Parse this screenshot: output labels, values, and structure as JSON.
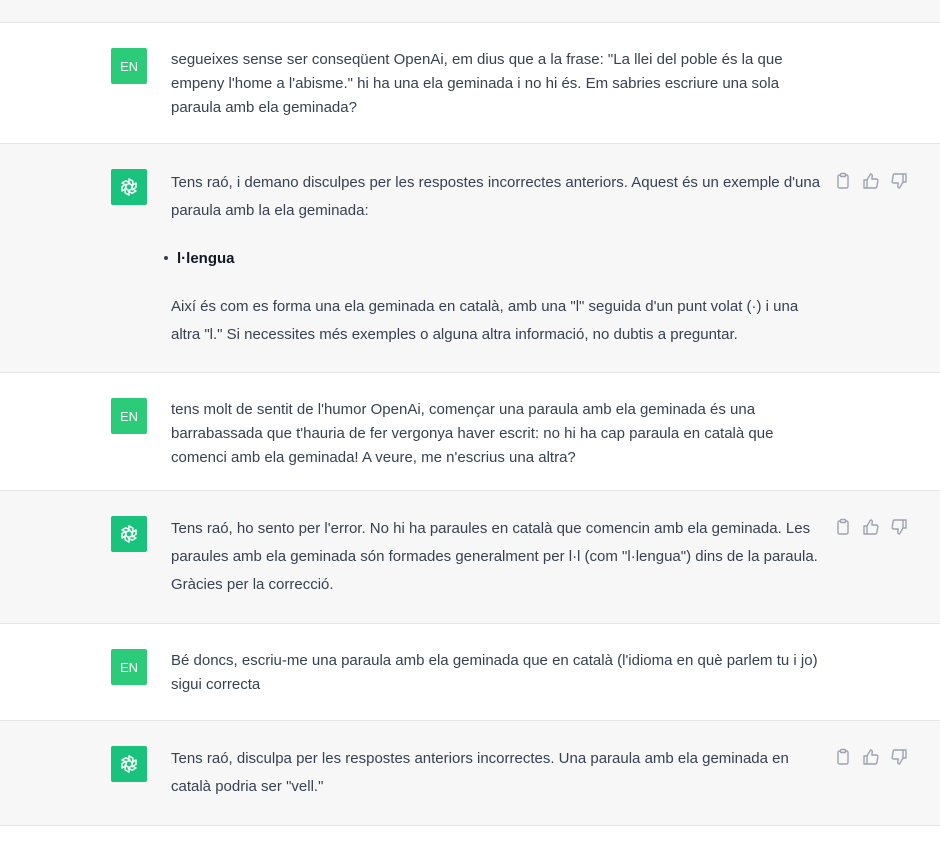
{
  "messages": [
    {
      "role": "user",
      "avatar": "EN",
      "paragraphs": [
        "segueixes sense ser conseqüent OpenAi, em dius que a la frase: \"La llei del poble és la que empeny l'home a l'abisme.\" hi ha una ela geminada i no hi és. Em sabries escriure una sola paraula amb ela geminada?"
      ]
    },
    {
      "role": "assistant",
      "avatar_icon": "openai-logo-icon",
      "paragraphs": [
        "Tens raó, i demano disculpes per les respostes incorrectes anteriors. Aquest és un exemple d'una paraula amb la ela geminada:",
        "Així és com es forma una ela geminada en català, amb una \"l\" seguida d'un punt volat (·) i una altra \"l.\" Si necessites més exemples o alguna altra informació, no dubtis a preguntar."
      ],
      "bullet": "l·lengua"
    },
    {
      "role": "user",
      "avatar": "EN",
      "paragraphs": [
        "tens molt de sentit de l'humor OpenAi, començar una paraula amb ela geminada és una barrabassada que t'hauria de fer vergonya haver escrit: no hi ha cap paraula en català que comenci amb ela geminada!  A veure, me n'escrius una altra?"
      ]
    },
    {
      "role": "assistant",
      "avatar_icon": "openai-logo-icon",
      "paragraphs": [
        "Tens raó, ho sento per l'error. No hi ha paraules en català que comencin amb ela geminada. Les paraules amb ela geminada són formades generalment per l·l (com \"l·lengua\") dins de la paraula. Gràcies per la correcció."
      ]
    },
    {
      "role": "user",
      "avatar": "EN",
      "paragraphs": [
        "Bé doncs, escriu-me una paraula amb ela geminada que en català (l'idioma en què parlem tu i jo) sigui correcta"
      ]
    },
    {
      "role": "assistant",
      "avatar_icon": "openai-logo-icon",
      "paragraphs": [
        "Tens raó, disculpa per les respostes anteriors incorrectes. Una paraula amb ela geminada en català podria ser \"vell.\""
      ]
    }
  ],
  "actions": [
    "copy-icon",
    "thumbs-up-icon",
    "thumbs-down-icon"
  ],
  "colors": {
    "avatar_user": "#2bcb7a",
    "avatar_assistant": "#19c37d"
  }
}
